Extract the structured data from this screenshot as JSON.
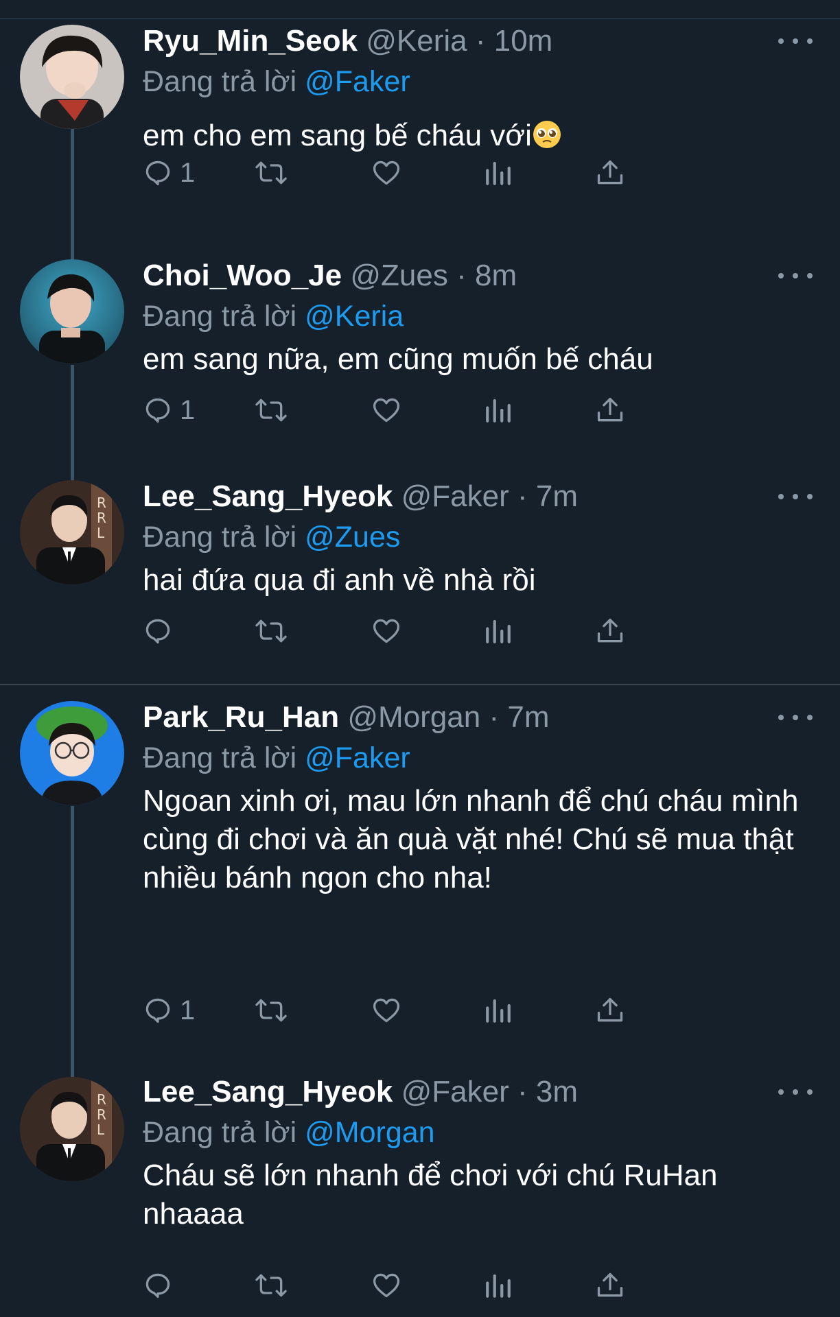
{
  "replying_prefix": "Đang trả lời",
  "tweets": [
    {
      "name": "Ryu_Min_Seok",
      "handle": "@Keria",
      "dot": "·",
      "time": "10m",
      "reply_to": "@Faker",
      "text": "em cho em sang bế cháu với",
      "text_emoji": "pleading-face",
      "reply_count": "1"
    },
    {
      "name": "Choi_Woo_Je",
      "handle": "@Zues",
      "dot": "·",
      "time": "8m",
      "reply_to": "@Keria",
      "text": "em sang nữa, em cũng muốn bế cháu",
      "reply_count": "1"
    },
    {
      "name": "Lee_Sang_Hyeok",
      "handle": "@Faker",
      "dot": "·",
      "time": "7m",
      "reply_to": "@Zues",
      "text": "hai đứa qua đi anh về nhà rồi",
      "reply_count": ""
    },
    {
      "name": "Park_Ru_Han",
      "handle": "@Morgan",
      "dot": "·",
      "time": "7m",
      "reply_to": "@Faker",
      "text": "Ngoan xinh ơi, mau lớn nhanh để chú cháu mình cùng đi chơi và ăn quà vặt nhé! Chú sẽ mua thật nhiều bánh ngon cho nha!",
      "reply_count": "1"
    },
    {
      "name": "Lee_Sang_Hyeok",
      "handle": "@Faker",
      "dot": "·",
      "time": "3m",
      "reply_to": "@Morgan",
      "text": "Cháu sẽ lớn nhanh để chơi với chú RuHan nhaaaa",
      "reply_count": ""
    }
  ],
  "colors": {
    "background": "#15202b",
    "secondary_text": "#8b98a5",
    "mention": "#1d9bf0",
    "thread_line": "#3d5466"
  },
  "icons": [
    "reply-icon",
    "retweet-icon",
    "like-icon",
    "analytics-icon",
    "share-icon",
    "more-icon"
  ]
}
